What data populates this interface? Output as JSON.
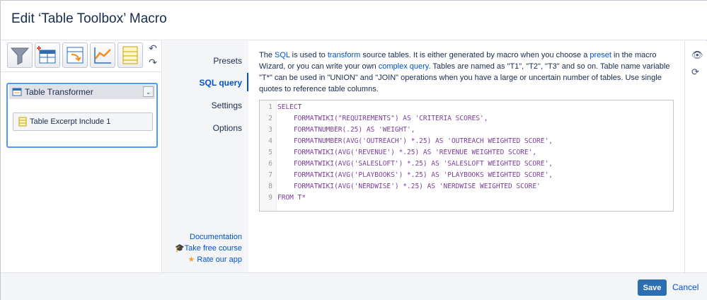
{
  "header": {
    "title": "Edit ‘Table Toolbox’ Macro"
  },
  "toolbar": {
    "tools": [
      {
        "name": "filter-tool-icon"
      },
      {
        "name": "add-table-tool-icon"
      },
      {
        "name": "transform-tool-icon"
      },
      {
        "name": "chart-tool-icon"
      },
      {
        "name": "excerpt-tool-icon"
      }
    ],
    "undo_icon": "↶",
    "redo_icon": "↷"
  },
  "macros": {
    "parent_label": "Table Transformer",
    "child_label": "Table Excerpt Include 1",
    "chevron": "⌄"
  },
  "nav": {
    "items": [
      {
        "label": "Presets"
      },
      {
        "label": "SQL query"
      },
      {
        "label": "Settings"
      },
      {
        "label": "Options"
      }
    ],
    "documentation": "Documentation",
    "course": "Take free course",
    "rate": "Rate our app"
  },
  "description": {
    "p1": "The ",
    "sql": "SQL",
    "p2": " is used to ",
    "transform": "transform",
    "p3": " source tables. It is either generated by macro when you choose a ",
    "preset": "preset",
    "p4": " in the macro Wizard, or you can write your own ",
    "complex": "complex query",
    "p5": ". Tables are named as \"T1\", \"T2\", \"T3\" and so on. Table name variable \"T*\" can be used in \"UNION\" and \"JOIN\" operations when you have a large or uncertain number of tables. Use single quotes to reference table columns."
  },
  "code": {
    "lines": [
      {
        "n": "1",
        "text": "SELECT"
      },
      {
        "n": "2",
        "text": "    FORMATWIKI(\"REQUIREMENTS\") AS 'CRITERIA SCORES',"
      },
      {
        "n": "3",
        "text": "    FORMATNUMBER(.25) AS 'WEIGHT',"
      },
      {
        "n": "4",
        "text": "    FORMATNUMBER(AVG('OUTREACH') *.25) AS 'OUTREACH WEIGHTED SCORE',"
      },
      {
        "n": "5",
        "text": "    FORMATWIKI(AVG('REVENUE') *.25) AS 'REVENUE WEIGHTED SCORE',"
      },
      {
        "n": "6",
        "text": "    FORMATWIKI(AVG('SALESLOFT') *.25) AS 'SALESLOFT WEIGHTED SCORE',"
      },
      {
        "n": "7",
        "text": "    FORMATWIKI(AVG('PLAYBOOKS') *.25) AS 'PLAYBOOKS WEIGHTED SCORE',"
      },
      {
        "n": "8",
        "text": "    FORMATWIKI(AVG('NERDWISE') *.25) AS 'NERDWISE WEIGHTED SCORE'"
      },
      {
        "n": "9",
        "text": "FROM T*"
      }
    ]
  },
  "side": {
    "preview_icon": "👁",
    "refresh_icon": "⟳"
  },
  "footer": {
    "save_label": "Save",
    "cancel_label": "Cancel"
  }
}
